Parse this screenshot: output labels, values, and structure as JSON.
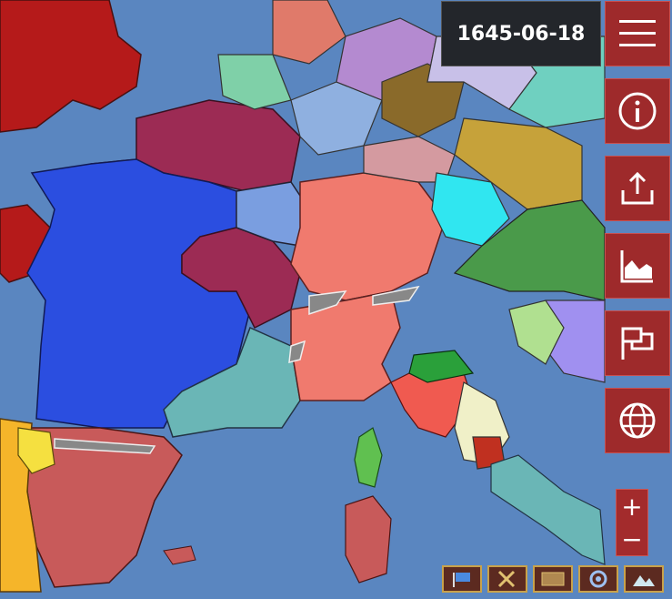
{
  "date": "1645-06-18",
  "sidebar": {
    "buttons": [
      {
        "name": "menu-icon"
      },
      {
        "name": "info-icon"
      },
      {
        "name": "share-icon"
      },
      {
        "name": "chart-icon"
      },
      {
        "name": "flag-icon"
      },
      {
        "name": "globe-icon"
      }
    ]
  },
  "zoom": {
    "in_label": "+",
    "out_label": "−"
  },
  "bottom_icons": [
    "flag-toggle-icon",
    "tools-icon",
    "map-icon",
    "settings-icon",
    "terrain-icon"
  ],
  "colors": {
    "sea": "#5a86c0",
    "button": "#9e2a2b",
    "date_bg": "#23262b"
  }
}
